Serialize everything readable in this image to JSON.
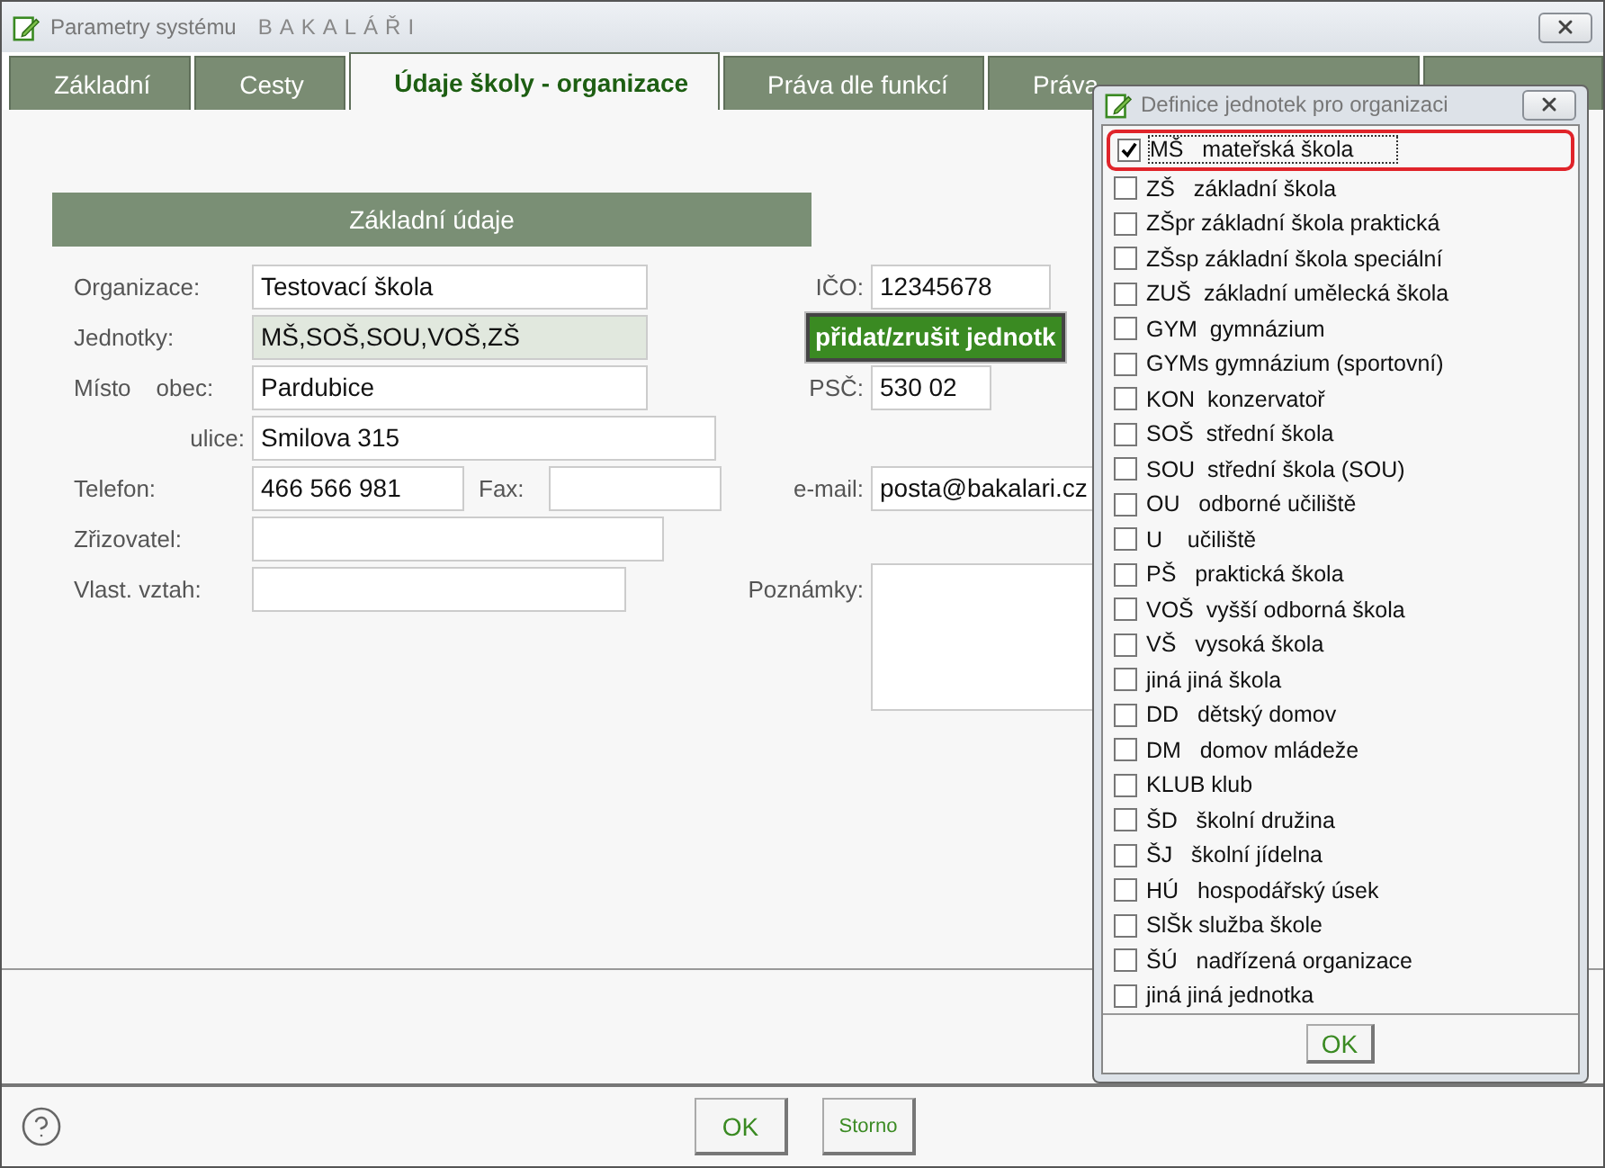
{
  "window": {
    "title": "Parametry systému",
    "brand": "BAKALÁŘI"
  },
  "tabs": [
    {
      "label": "Základní",
      "selected": false
    },
    {
      "label": "Cesty",
      "selected": false
    },
    {
      "label": "Údaje školy - organizace",
      "selected": true
    },
    {
      "label": "Práva dle funkcí",
      "selected": false
    },
    {
      "label": "Práva",
      "selected": false
    },
    {
      "selected": false
    }
  ],
  "section": {
    "title": "Základní údaje"
  },
  "form": {
    "organizace": {
      "label": "Organizace:",
      "value": "Testovací škola"
    },
    "ico": {
      "label": "IČO:",
      "value": "12345678"
    },
    "jednotky": {
      "label": "Jednotky:",
      "value": "MŠ,SOŠ,SOU,VOŠ,ZŠ"
    },
    "units_button": "přidat/zrušit jednotk",
    "misto": {
      "label": "Místo",
      "sublabel": "obec:",
      "value": "Pardubice"
    },
    "psc": {
      "label": "PSČ:",
      "value": "530 02"
    },
    "ulice": {
      "label": "ulice:",
      "value": "Smilova 315"
    },
    "telefon": {
      "label": "Telefon:",
      "value": "466 566 981"
    },
    "fax": {
      "label": "Fax:"
    },
    "email": {
      "label": "e-mail:",
      "value": "posta@bakalari.cz"
    },
    "zrizovatel": {
      "label": "Zřizovatel:"
    },
    "vztah": {
      "label": "Vlast. vztah:"
    },
    "poznamky": {
      "label": "Poznámky:"
    }
  },
  "footer": {
    "ok": "OK",
    "cancel": "Storno"
  },
  "dialog": {
    "title": "Definice jednotek pro organizaci",
    "ok": "OK",
    "items": [
      {
        "label": "MŠ   mateřská škola",
        "checked": true,
        "highlighted": true
      },
      {
        "label": "ZŠ   základní škola",
        "checked": false,
        "highlighted": false
      },
      {
        "label": "ZŠpr základní škola praktická",
        "checked": false,
        "highlighted": false
      },
      {
        "label": "ZŠsp základní škola speciální",
        "checked": false,
        "highlighted": false
      },
      {
        "label": "ZUŠ  základní umělecká škola",
        "checked": false,
        "highlighted": false
      },
      {
        "label": "GYM  gymnázium",
        "checked": false,
        "highlighted": false
      },
      {
        "label": "GYMs gymnázium (sportovní)",
        "checked": false,
        "highlighted": false
      },
      {
        "label": "KON  konzervatoř",
        "checked": false,
        "highlighted": false
      },
      {
        "label": "SOŠ  střední škola",
        "checked": false,
        "highlighted": false
      },
      {
        "label": "SOU  střední škola (SOU)",
        "checked": false,
        "highlighted": false
      },
      {
        "label": "OU   odborné učiliště",
        "checked": false,
        "highlighted": false
      },
      {
        "label": "U    učiliště",
        "checked": false,
        "highlighted": false
      },
      {
        "label": "PŠ   praktická škola",
        "checked": false,
        "highlighted": false
      },
      {
        "label": "VOŠ  vyšší odborná škola",
        "checked": false,
        "highlighted": false
      },
      {
        "label": "VŠ   vysoká škola",
        "checked": false,
        "highlighted": false
      },
      {
        "label": "jiná jiná škola",
        "checked": false,
        "highlighted": false
      },
      {
        "label": "DD   dětský domov",
        "checked": false,
        "highlighted": false
      },
      {
        "label": "DM   domov mládeže",
        "checked": false,
        "highlighted": false
      },
      {
        "label": "KLUB klub",
        "checked": false,
        "highlighted": false
      },
      {
        "label": "ŠD   školní družina",
        "checked": false,
        "highlighted": false
      },
      {
        "label": "ŠJ   školní jídelna",
        "checked": false,
        "highlighted": false
      },
      {
        "label": "HÚ   hospodářský úsek",
        "checked": false,
        "highlighted": false
      },
      {
        "label": "SlŠk služba škole",
        "checked": false,
        "highlighted": false
      },
      {
        "label": "ŠÚ   nadřízená organizace",
        "checked": false,
        "highlighted": false
      },
      {
        "label": "jiná jiná jednotka",
        "checked": false,
        "highlighted": false
      }
    ]
  }
}
